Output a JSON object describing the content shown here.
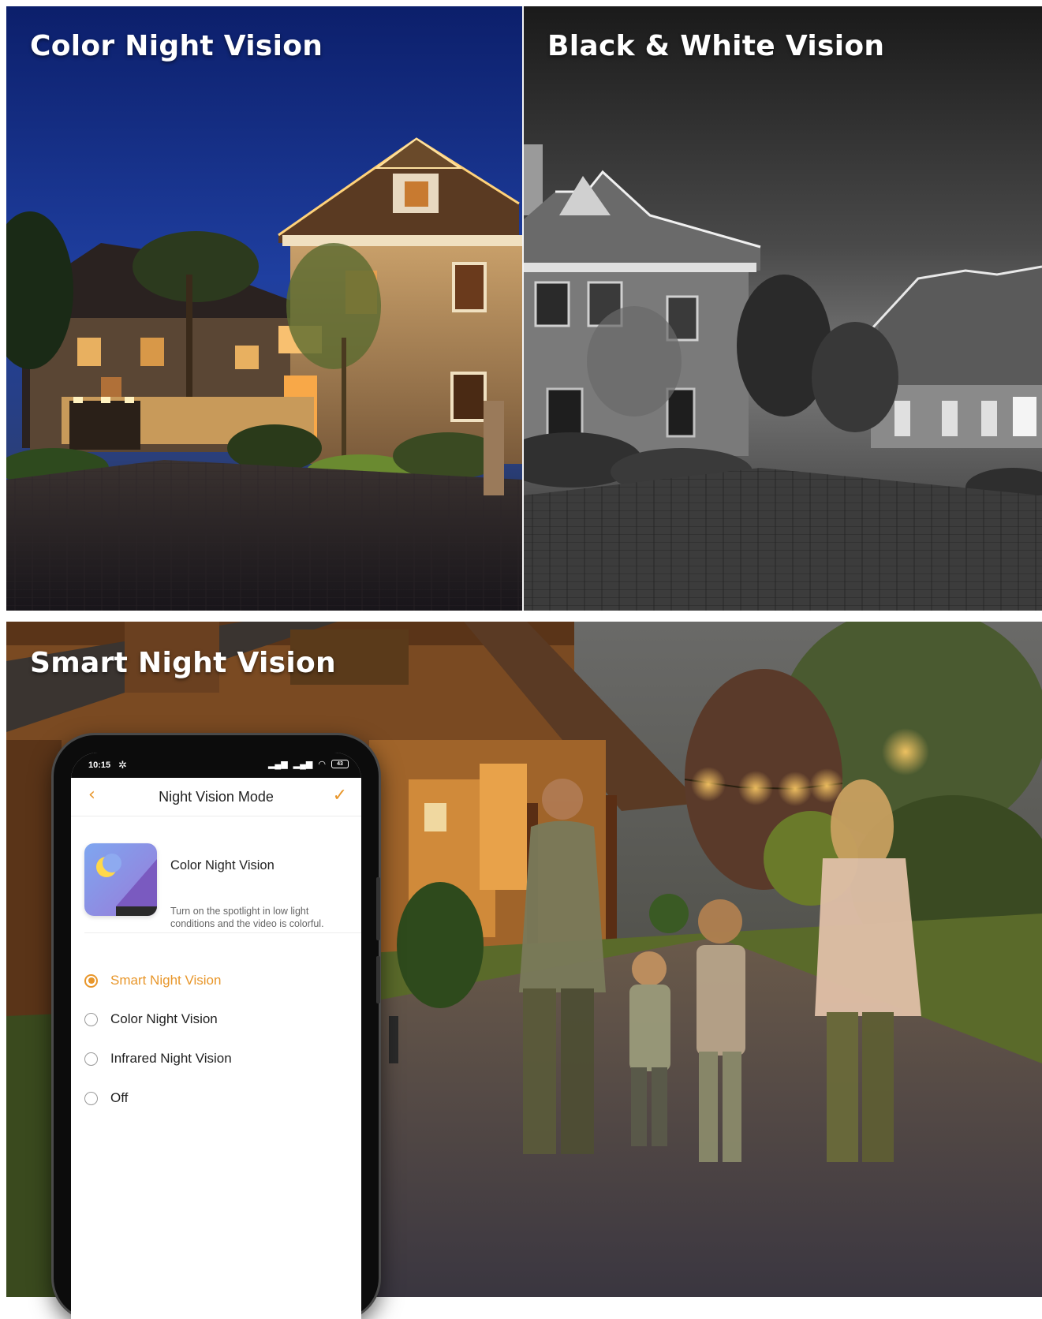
{
  "panels": {
    "color": {
      "title": "Color Night Vision"
    },
    "bw": {
      "title": "Black & White Vision"
    },
    "smart": {
      "title": "Smart Night Vision"
    }
  },
  "phone": {
    "status": {
      "time": "10:15",
      "battery": "43"
    },
    "nav": {
      "title": "Night Vision Mode",
      "back_icon": "chevron-left-icon",
      "confirm_icon": "check-icon"
    },
    "current_mode": {
      "title": "Color Night Vision",
      "description": "Turn on the spotlight in low light conditions and the video is colorful."
    },
    "options": [
      {
        "label": "Smart Night Vision",
        "selected": true
      },
      {
        "label": "Color Night Vision",
        "selected": false
      },
      {
        "label": "Infrared Night Vision",
        "selected": false
      },
      {
        "label": "Off",
        "selected": false
      }
    ]
  },
  "colors": {
    "accent": "#e8962a",
    "night_sky": "#1c3a9a"
  }
}
